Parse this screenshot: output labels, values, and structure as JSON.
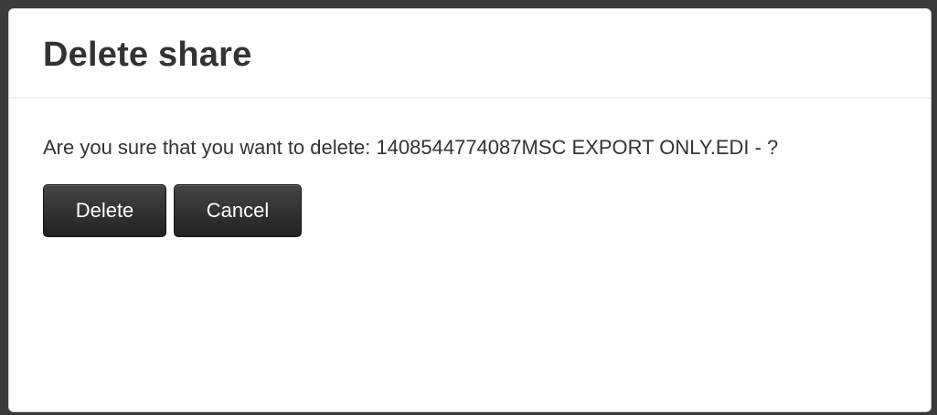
{
  "dialog": {
    "title": "Delete share",
    "message": "Are you sure that you want to delete: 1408544774087MSC EXPORT ONLY.EDI - ?",
    "delete_label": "Delete",
    "cancel_label": "Cancel"
  },
  "colors": {
    "backdrop": "#2b2b2b",
    "dialog_background": "#ffffff",
    "button_background": "#2f2f2f",
    "button_text": "#ffffff",
    "text": "#333333"
  }
}
